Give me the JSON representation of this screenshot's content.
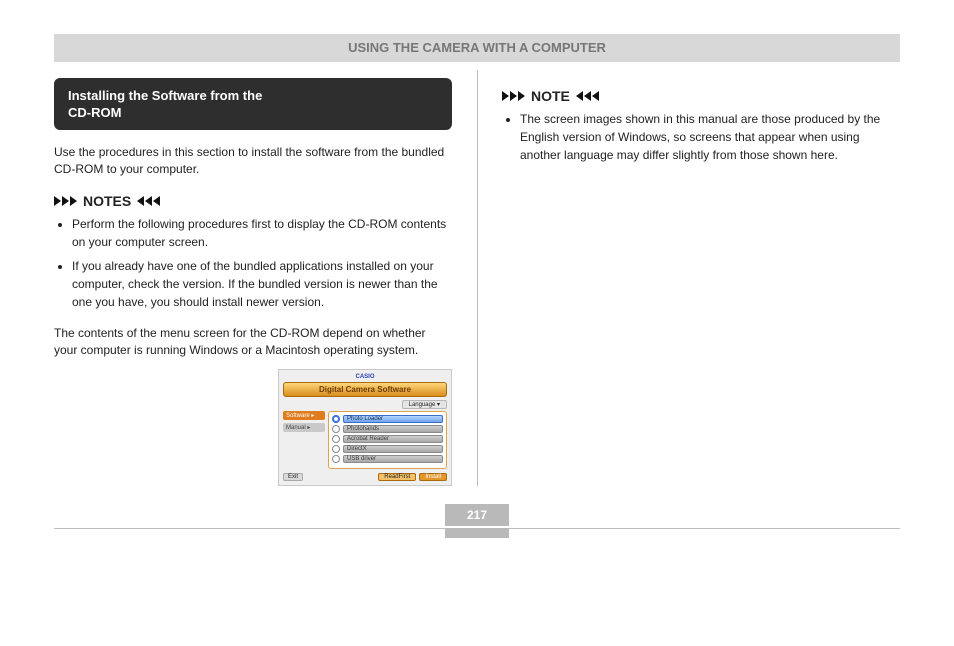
{
  "header": {
    "section_title": "USING THE CAMERA WITH A COMPUTER"
  },
  "left": {
    "boxTitle1": "Installing the Software from the",
    "boxTitle2": "CD-ROM",
    "lead": "Use the procedures in this section to install the software from the bundled CD-ROM to your computer.",
    "notesTitle": "NOTES",
    "notes": [
      "Perform the following procedures first to display the CD-ROM contents on your computer screen.",
      "If you already have one of the bundled applications installed on your computer, check the version. If the bundled version is newer than the one you have, you should install newer version."
    ],
    "sub": "The contents of the menu screen for the CD-ROM depend on whether your computer is running Windows or a Macintosh operating system.",
    "mini": {
      "brand": "CASIO",
      "title": "Digital Camera Software",
      "langLabel": "Language ▾",
      "tabs": [
        "Software ▸",
        "Manual  ▸"
      ],
      "items": [
        "Photo Loader",
        "Photohands",
        "Acrobat Reader",
        "DirectX",
        "USB driver"
      ],
      "exit": "Exit",
      "readme": "ReadFirst",
      "install": "Install"
    }
  },
  "right": {
    "notesTitle": "NOTE",
    "notes": [
      "The screen images shown in this manual are those produced by the English version of Windows, so screens that appear when using another language may differ slightly from those shown here."
    ]
  },
  "page": "217"
}
